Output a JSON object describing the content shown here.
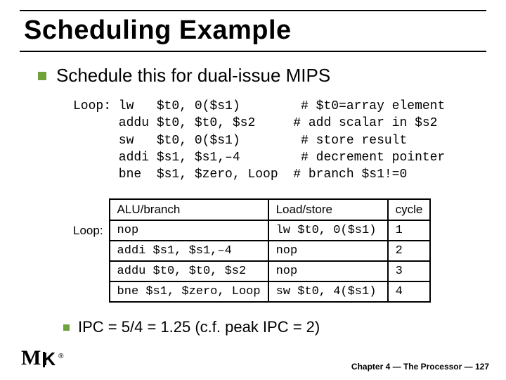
{
  "title": "Scheduling Example",
  "bullet_main": "Schedule this for dual-issue MIPS",
  "code_block": "Loop: lw   $t0, 0($s1)        # $t0=array element\n      addu $t0, $t0, $s2     # add scalar in $s2\n      sw   $t0, 0($s1)        # store result\n      addi $s1, $s1,–4        # decrement pointer\n      bne  $s1, $zero, Loop  # branch $s1!=0",
  "table": {
    "headers": {
      "alu": "ALU/branch",
      "ls": "Load/store",
      "cycle": "cycle"
    },
    "label": "Loop:",
    "rows": [
      {
        "alu": "nop",
        "ls": "lw   $t0, 0($s1)",
        "cycle": "1"
      },
      {
        "alu": "addi $s1, $s1,–4",
        "ls": "nop",
        "cycle": "2"
      },
      {
        "alu": "addu $t0, $t0, $s2",
        "ls": "nop",
        "cycle": "3"
      },
      {
        "alu": "bne  $s1, $zero, Loop",
        "ls": "sw   $t0, 4($s1)",
        "cycle": "4"
      }
    ]
  },
  "ipc_line": "IPC = 5/4 = 1.25 (c.f. peak IPC = 2)",
  "footer": "Chapter 4 — The Processor — 127",
  "chart_data": {
    "type": "table",
    "title": "Dual-issue schedule",
    "columns": [
      "ALU/branch",
      "Load/store",
      "cycle"
    ],
    "rows": [
      [
        "nop",
        "lw $t0, 0($s1)",
        1
      ],
      [
        "addi $s1, $s1, -4",
        "nop",
        2
      ],
      [
        "addu $t0, $t0, $s2",
        "nop",
        3
      ],
      [
        "bne $s1, $zero, Loop",
        "sw $t0, 4($s1)",
        4
      ]
    ]
  }
}
